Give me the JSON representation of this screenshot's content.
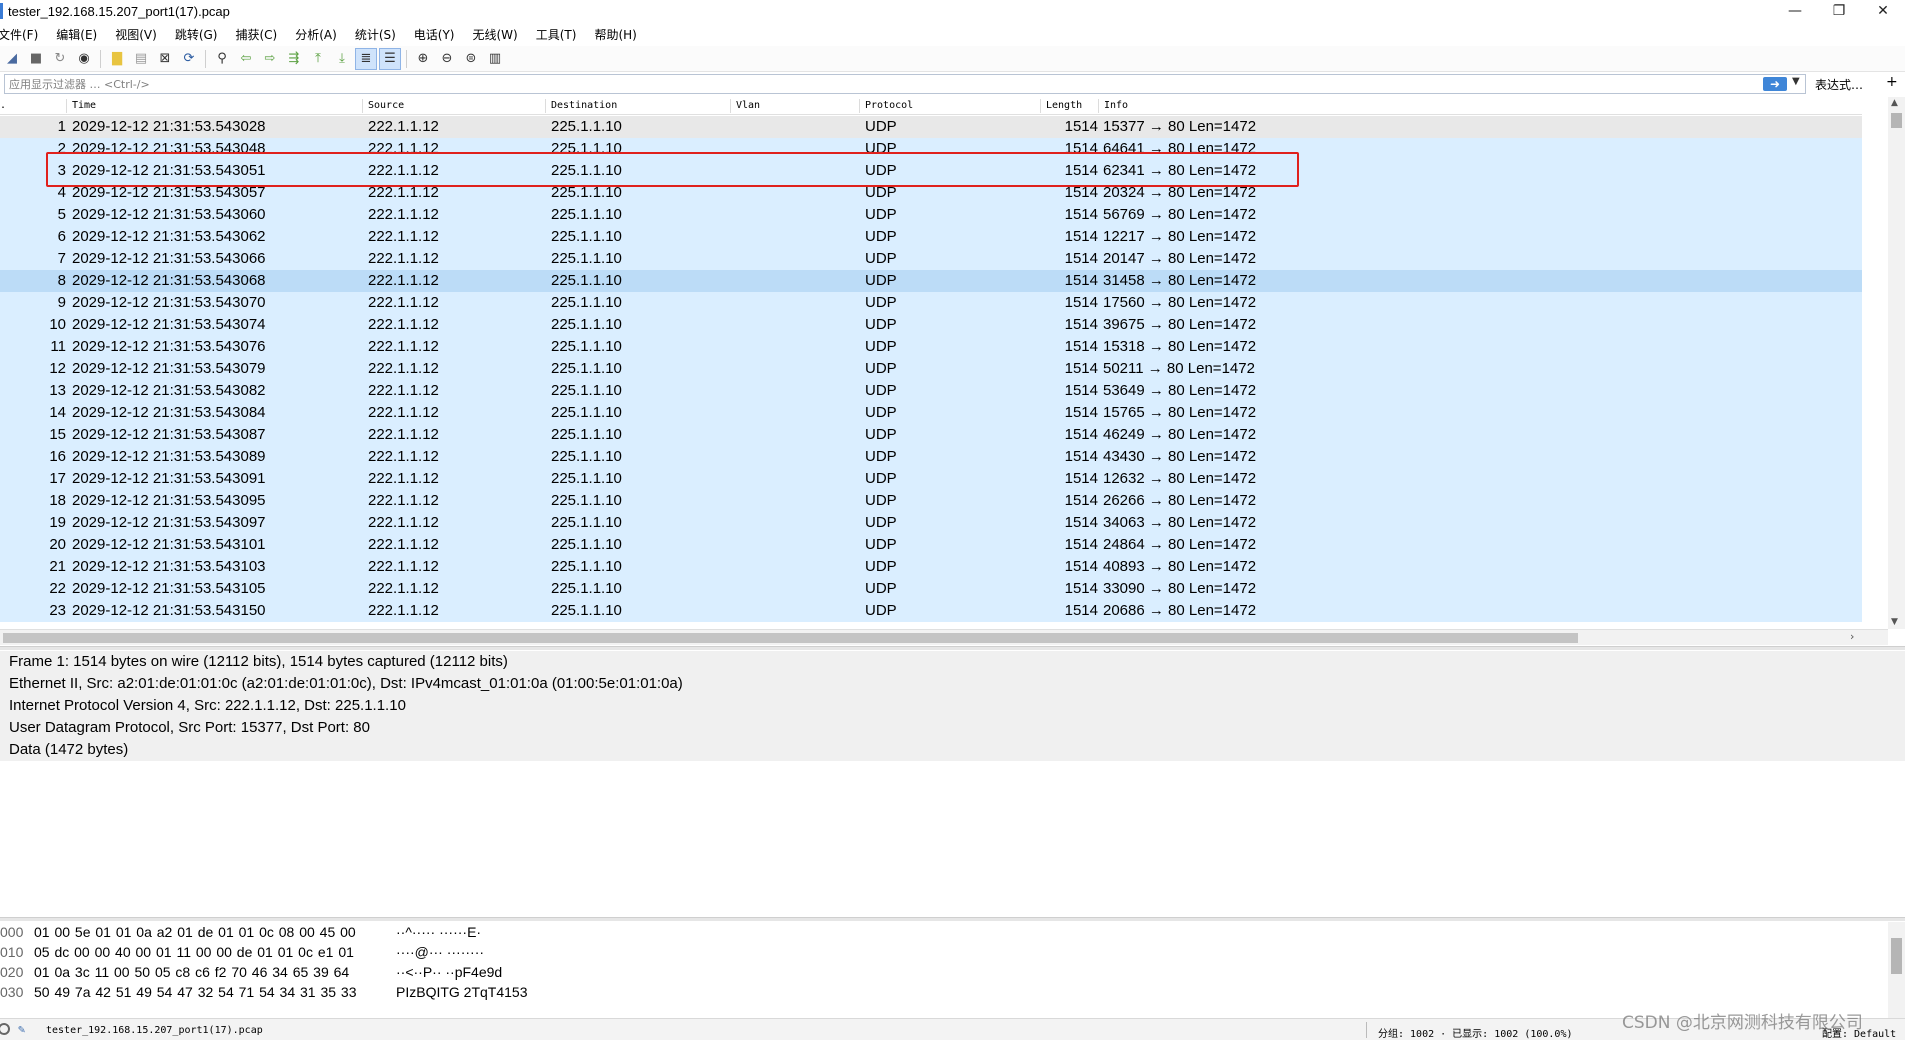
{
  "window": {
    "title": "tester_192.168.15.207_port1(17).pcap",
    "controls": {
      "minimize": "—",
      "restore": "❐",
      "close": "✕"
    }
  },
  "menu": [
    "文件(F)",
    "编辑(E)",
    "视图(V)",
    "跳转(G)",
    "捕获(C)",
    "分析(A)",
    "统计(S)",
    "电话(Y)",
    "无线(W)",
    "工具(T)",
    "帮助(H)"
  ],
  "toolbar": {
    "icons": [
      "shark-fin-start-icon",
      "stop-icon",
      "restart-icon",
      "options-icon",
      "open-file-icon",
      "save-icon",
      "close-file-icon",
      "reload-icon",
      "find-icon",
      "back-arrow-icon",
      "forward-arrow-icon",
      "goto-packet-icon",
      "first-packet-icon",
      "last-packet-icon",
      "autoscroll-icon",
      "colorize-icon",
      "zoom-in-icon",
      "zoom-out-icon",
      "zoom-normal-icon",
      "resize-columns-icon"
    ]
  },
  "filter": {
    "placeholder": "应用显示过滤器 … <Ctrl-/>",
    "expression_label": "表达式…",
    "plus_label": "+"
  },
  "packet_list": {
    "columns": [
      ".",
      "Time",
      "Source",
      "Destination",
      "Vlan",
      "Protocol",
      "Length",
      "Info"
    ],
    "rows": [
      {
        "no": "1",
        "time": "2029-12-12 21:31:53.543028",
        "src": "222.1.1.12",
        "dst": "225.1.1.10",
        "proto": "UDP",
        "len": "1514",
        "info": "15377 → 80 Len=1472"
      },
      {
        "no": "2",
        "time": "2029-12-12 21:31:53.543048",
        "src": "222.1.1.12",
        "dst": "225.1.1.10",
        "proto": "UDP",
        "len": "1514",
        "info": "64641 → 80 Len=1472"
      },
      {
        "no": "3",
        "time": "2029-12-12 21:31:53.543051",
        "src": "222.1.1.12",
        "dst": "225.1.1.10",
        "proto": "UDP",
        "len": "1514",
        "info": "62341 → 80 Len=1472"
      },
      {
        "no": "4",
        "time": "2029-12-12 21:31:53.543057",
        "src": "222.1.1.12",
        "dst": "225.1.1.10",
        "proto": "UDP",
        "len": "1514",
        "info": "20324 → 80 Len=1472"
      },
      {
        "no": "5",
        "time": "2029-12-12 21:31:53.543060",
        "src": "222.1.1.12",
        "dst": "225.1.1.10",
        "proto": "UDP",
        "len": "1514",
        "info": "56769 → 80 Len=1472"
      },
      {
        "no": "6",
        "time": "2029-12-12 21:31:53.543062",
        "src": "222.1.1.12",
        "dst": "225.1.1.10",
        "proto": "UDP",
        "len": "1514",
        "info": "12217 → 80 Len=1472"
      },
      {
        "no": "7",
        "time": "2029-12-12 21:31:53.543066",
        "src": "222.1.1.12",
        "dst": "225.1.1.10",
        "proto": "UDP",
        "len": "1514",
        "info": "20147 → 80 Len=1472"
      },
      {
        "no": "8",
        "time": "2029-12-12 21:31:53.543068",
        "src": "222.1.1.12",
        "dst": "225.1.1.10",
        "proto": "UDP",
        "len": "1514",
        "info": "31458 → 80 Len=1472"
      },
      {
        "no": "9",
        "time": "2029-12-12 21:31:53.543070",
        "src": "222.1.1.12",
        "dst": "225.1.1.10",
        "proto": "UDP",
        "len": "1514",
        "info": "17560 → 80 Len=1472"
      },
      {
        "no": "10",
        "time": "2029-12-12 21:31:53.543074",
        "src": "222.1.1.12",
        "dst": "225.1.1.10",
        "proto": "UDP",
        "len": "1514",
        "info": "39675 → 80 Len=1472"
      },
      {
        "no": "11",
        "time": "2029-12-12 21:31:53.543076",
        "src": "222.1.1.12",
        "dst": "225.1.1.10",
        "proto": "UDP",
        "len": "1514",
        "info": "15318 → 80 Len=1472"
      },
      {
        "no": "12",
        "time": "2029-12-12 21:31:53.543079",
        "src": "222.1.1.12",
        "dst": "225.1.1.10",
        "proto": "UDP",
        "len": "1514",
        "info": "50211 → 80 Len=1472"
      },
      {
        "no": "13",
        "time": "2029-12-12 21:31:53.543082",
        "src": "222.1.1.12",
        "dst": "225.1.1.10",
        "proto": "UDP",
        "len": "1514",
        "info": "53649 → 80 Len=1472"
      },
      {
        "no": "14",
        "time": "2029-12-12 21:31:53.543084",
        "src": "222.1.1.12",
        "dst": "225.1.1.10",
        "proto": "UDP",
        "len": "1514",
        "info": "15765 → 80 Len=1472"
      },
      {
        "no": "15",
        "time": "2029-12-12 21:31:53.543087",
        "src": "222.1.1.12",
        "dst": "225.1.1.10",
        "proto": "UDP",
        "len": "1514",
        "info": "46249 → 80 Len=1472"
      },
      {
        "no": "16",
        "time": "2029-12-12 21:31:53.543089",
        "src": "222.1.1.12",
        "dst": "225.1.1.10",
        "proto": "UDP",
        "len": "1514",
        "info": "43430 → 80 Len=1472"
      },
      {
        "no": "17",
        "time": "2029-12-12 21:31:53.543091",
        "src": "222.1.1.12",
        "dst": "225.1.1.10",
        "proto": "UDP",
        "len": "1514",
        "info": "12632 → 80 Len=1472"
      },
      {
        "no": "18",
        "time": "2029-12-12 21:31:53.543095",
        "src": "222.1.1.12",
        "dst": "225.1.1.10",
        "proto": "UDP",
        "len": "1514",
        "info": "26266 → 80 Len=1472"
      },
      {
        "no": "19",
        "time": "2029-12-12 21:31:53.543097",
        "src": "222.1.1.12",
        "dst": "225.1.1.10",
        "proto": "UDP",
        "len": "1514",
        "info": "34063 → 80 Len=1472"
      },
      {
        "no": "20",
        "time": "2029-12-12 21:31:53.543101",
        "src": "222.1.1.12",
        "dst": "225.1.1.10",
        "proto": "UDP",
        "len": "1514",
        "info": "24864 → 80 Len=1472"
      },
      {
        "no": "21",
        "time": "2029-12-12 21:31:53.543103",
        "src": "222.1.1.12",
        "dst": "225.1.1.10",
        "proto": "UDP",
        "len": "1514",
        "info": "40893 → 80 Len=1472"
      },
      {
        "no": "22",
        "time": "2029-12-12 21:31:53.543105",
        "src": "222.1.1.12",
        "dst": "225.1.1.10",
        "proto": "UDP",
        "len": "1514",
        "info": "33090 → 80 Len=1472"
      },
      {
        "no": "23",
        "time": "2029-12-12 21:31:53.543150",
        "src": "222.1.1.12",
        "dst": "225.1.1.10",
        "proto": "UDP",
        "len": "1514",
        "info": "20686 → 80 Len=1472"
      }
    ],
    "selected_row": "8",
    "highlighted_row": "3",
    "colors": {
      "row_bg": "#daeeff",
      "first_row_bg": "#e8e8e8",
      "selected_bg": "#bcdcf7",
      "highlight_border": "#e0201c"
    }
  },
  "details": [
    "Frame 1: 1514 bytes on wire (12112 bits), 1514 bytes captured (12112 bits)",
    "Ethernet II, Src: a2:01:de:01:01:0c (a2:01:de:01:01:0c), Dst: IPv4mcast_01:01:0a (01:00:5e:01:01:0a)",
    "Internet Protocol Version 4, Src: 222.1.1.12, Dst: 225.1.1.10",
    "User Datagram Protocol, Src Port: 15377, Dst Port: 80",
    "Data (1472 bytes)"
  ],
  "bytes": [
    {
      "off": "000",
      "hex": "01 00 5e 01 01 0a a2 01  de 01 01 0c 08 00 45 00",
      "ascii": "··^····· ······E·"
    },
    {
      "off": "010",
      "hex": "05 dc 00 00 40 00 01 11  00 00 de 01 01 0c e1 01",
      "ascii": "····@··· ········"
    },
    {
      "off": "020",
      "hex": "01 0a 3c 11 00 50 05 c8  c6 f2 70 46 34 65 39 64",
      "ascii": "··<··P·· ··pF4e9d"
    },
    {
      "off": "030",
      "hex": "50 49 7a 42 51 49 54 47  32 54 71 54 34 31 35 33",
      "ascii": "PIzBQITG 2TqT4153"
    }
  ],
  "status": {
    "file": "tester_192.168.15.207_port1(17).pcap",
    "stats": "分组: 1002 · 已显示: 1002 (100.0%)",
    "profile": "配置: Default"
  },
  "watermark": "CSDN @北京网测科技有限公司"
}
